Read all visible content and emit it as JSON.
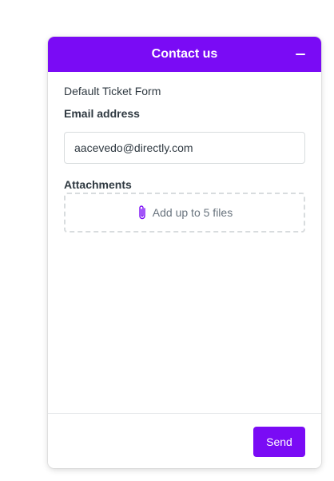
{
  "header": {
    "title": "Contact us",
    "minimize_icon": "minus-icon",
    "background": "#7a0bf5"
  },
  "form": {
    "name": "Default Ticket Form",
    "email": {
      "label": "Email address",
      "value": "aacevedo@directly.com"
    },
    "attachments": {
      "label": "Attachments",
      "dropzone_text": "Add up to 5 files",
      "icon": "paperclip-icon"
    }
  },
  "footer": {
    "send_label": "Send",
    "accent": "#7a0bf5"
  }
}
